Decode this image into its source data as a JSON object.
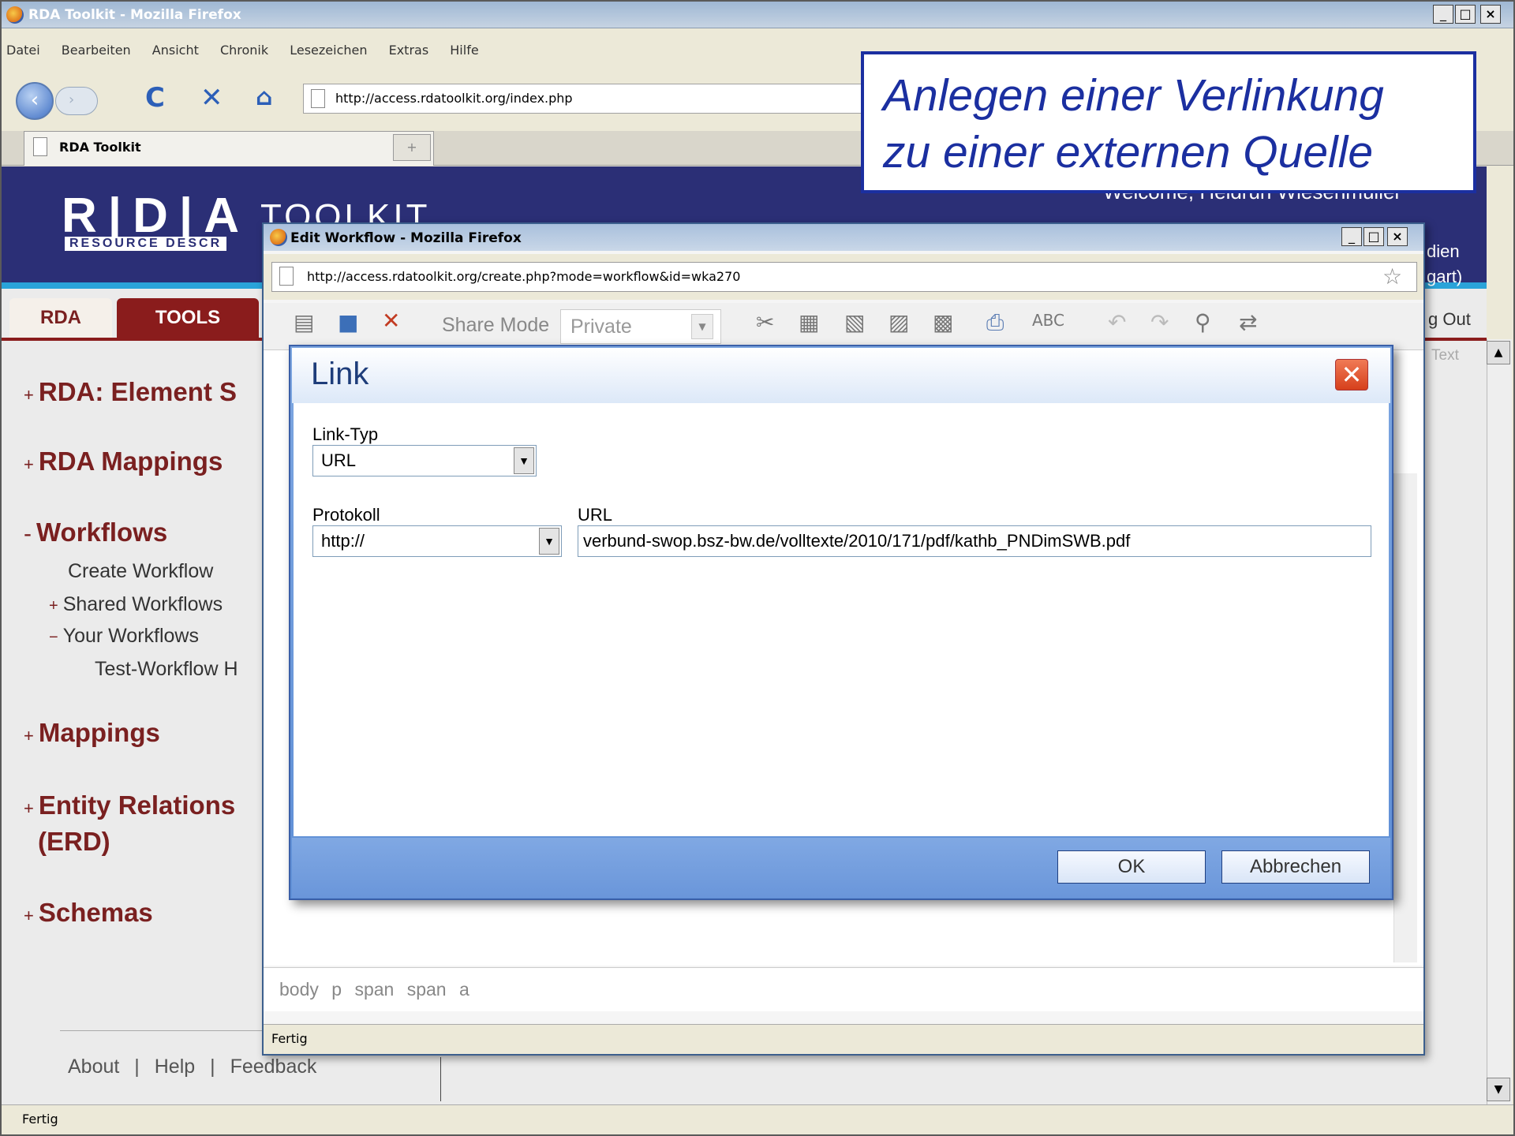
{
  "window": {
    "title": "RDA Toolkit - Mozilla Firefox",
    "min": "_",
    "max": "□",
    "close": "×"
  },
  "menu": [
    "Datei",
    "Bearbeiten",
    "Ansicht",
    "Chronik",
    "Lesezeichen",
    "Extras",
    "Hilfe"
  ],
  "nav": {
    "url": "http://access.rdatoolkit.org/index.php",
    "back": "‹",
    "forward": "›",
    "reload": "C",
    "stop": "✕",
    "home": "⌂"
  },
  "tab": {
    "label": "RDA Toolkit",
    "new_tab": "+"
  },
  "site": {
    "logo_letters": "R|D|A",
    "logo_toolkit": "TOOLKIT",
    "logo_sub": "RESOURCE DESCR",
    "welcome": "Welcome, Heidrun Wiesenmüller",
    "right_edge": {
      "dien": "dien",
      "gart": "gart)",
      "logout": "g Out",
      "text": "Text"
    },
    "tabs": {
      "rda": "RDA",
      "tools": "TOOLS"
    },
    "sidebar": {
      "element": "RDA: Element S",
      "mappings_rda": "RDA Mappings",
      "workflows": "Workflows",
      "create_workflow": "Create Workflow",
      "shared_workflows": "Shared Workflows",
      "your_workflows": "Your Workflows",
      "test_workflow": "Test-Workflow H",
      "mappings": "Mappings",
      "erd_1": "Entity Relations",
      "erd_2": "(ERD)",
      "schemas": "Schemas",
      "plus": "+",
      "minus": "-",
      "plus_small": "+",
      "minus_small": "−"
    },
    "footer": {
      "about": "About",
      "help": "Help",
      "feedback": "Feedback",
      "sep": "|"
    }
  },
  "status": "Fertig",
  "popup": {
    "title": "Edit Workflow - Mozilla Firefox",
    "url": "http://access.rdatoolkit.org/create.php?mode=workflow&id=wka270",
    "share_mode_label": "Share Mode",
    "share_mode_value": "Private",
    "path": "body p span span a",
    "status": "Fertig"
  },
  "dialog": {
    "title": "Link",
    "close": "✕",
    "link_type_label": "Link-Typ",
    "link_type_value": "URL",
    "protocol_label": "Protokoll",
    "protocol_value": "http://",
    "url_label": "URL",
    "url_value": "verbund-swop.bsz-bw.de/volltexte/2010/171/pdf/kathb_PNDimSWB.pdf",
    "ok": "OK",
    "cancel": "Abbrechen",
    "arrow": "▼"
  },
  "annotation": {
    "line1": "Anlegen einer Verlinkung",
    "line2": "zu einer externen Quelle"
  },
  "colors": {
    "banner": "#2b2f76",
    "accent": "#7a2020",
    "dialog": "#6a96da",
    "annotation": "#1b2fa0"
  }
}
